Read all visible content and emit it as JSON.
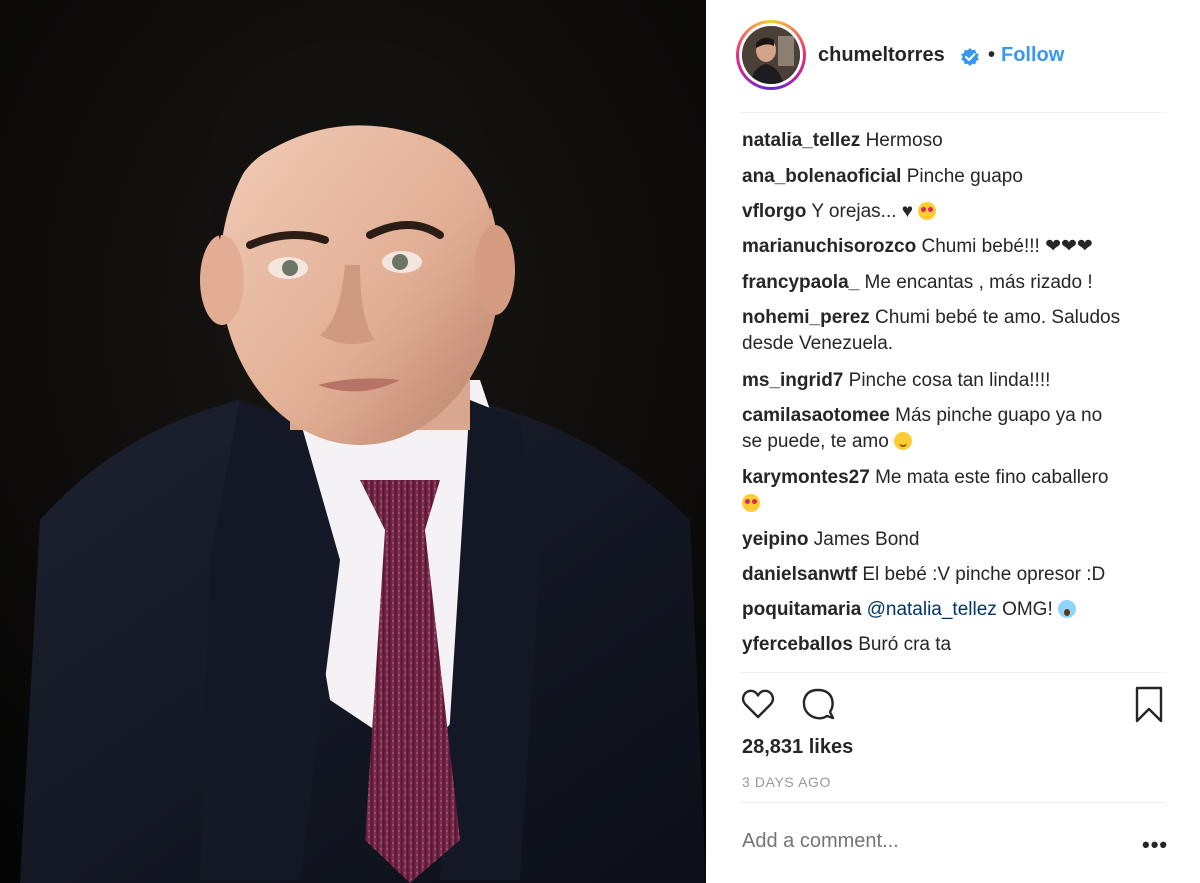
{
  "post": {
    "author": "chumeltorres",
    "follow_label": "Follow",
    "separator": "•"
  },
  "comments": [
    {
      "user": "natalia_tellez",
      "text": "Hermoso"
    },
    {
      "user": "ana_bolenaoficial",
      "text": "Pinche guapo"
    },
    {
      "user": "vflorgo",
      "text": "Y orejas... ♥"
    },
    {
      "user": "marianuchisorozco",
      "text": "Chumi bebé!!! ❤❤❤"
    },
    {
      "user": "francypaola_",
      "text": "Me encantas , más rizado !"
    },
    {
      "user": "nohemi_perez",
      "text": "Chumi bebé te amo. Saludos",
      "text2": "desde Venezuela."
    },
    {
      "user": "ms_ingrid7",
      "text": "Pinche cosa tan linda!!!!"
    },
    {
      "user": "camilasaotomee",
      "text": "Más pinche guapo ya no",
      "text2": "se puede, te amo"
    },
    {
      "user": "karymontes27",
      "text": "Me mata este fino caballero"
    },
    {
      "user": "yeipino",
      "text": "James Bond"
    },
    {
      "user": "danielsanwtf",
      "text": "El bebé :V pinche opresor :D"
    },
    {
      "user": "poquitamaria",
      "mention": "@natalia_tellez",
      "text": "OMG!"
    },
    {
      "user": "yferceballos",
      "text": "Buró cra ta"
    }
  ],
  "icons": {
    "like": "heart-outline-icon",
    "comment": "speech-bubble-icon",
    "save": "bookmark-icon",
    "verified": "verified-badge-icon",
    "more": "more-options-icon"
  },
  "stats": {
    "likes": "28,831 likes",
    "date": "3 DAYS AGO"
  },
  "composer": {
    "placeholder": "Add a comment...",
    "more_label": "•••"
  },
  "colors": {
    "accent": "#3897f0",
    "text": "#262626",
    "muted": "#999999",
    "border": "#efefef"
  }
}
